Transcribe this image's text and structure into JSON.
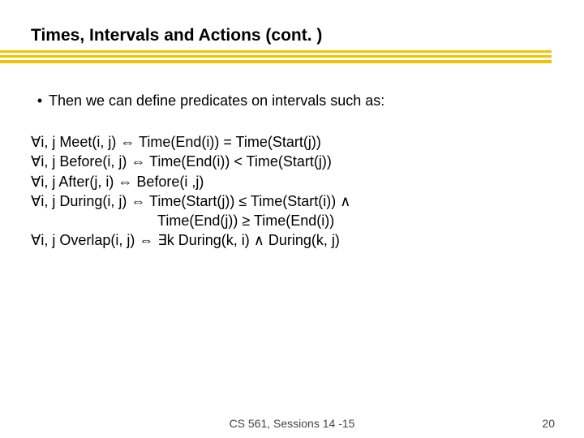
{
  "title": "Times, Intervals and Actions (cont. )",
  "bullet": {
    "marker": "•",
    "text": "Then we can define predicates on intervals such as:"
  },
  "predicates": {
    "l1": "∀i, j Meet(i, j) ⇔ Time(End(i)) = Time(Start(j))",
    "l2": "∀i, j Before(i, j) ⇔ Time(End(i)) < Time(Start(j))",
    "l3": "∀i, j After(j, i) ⇔ Before(i ,j)",
    "l4": "∀i, j During(i, j) ⇔ Time(Start(j)) ≤ Time(Start(i)) ∧",
    "l5": "Time(End(j)) ≥ Time(End(i))",
    "l6": "∀i, j Overlap(i, j) ⇔ ∃k During(k, i) ∧ During(k, j)"
  },
  "footer": {
    "course": "CS 561,  Sessions 14 -15",
    "page": "20"
  }
}
